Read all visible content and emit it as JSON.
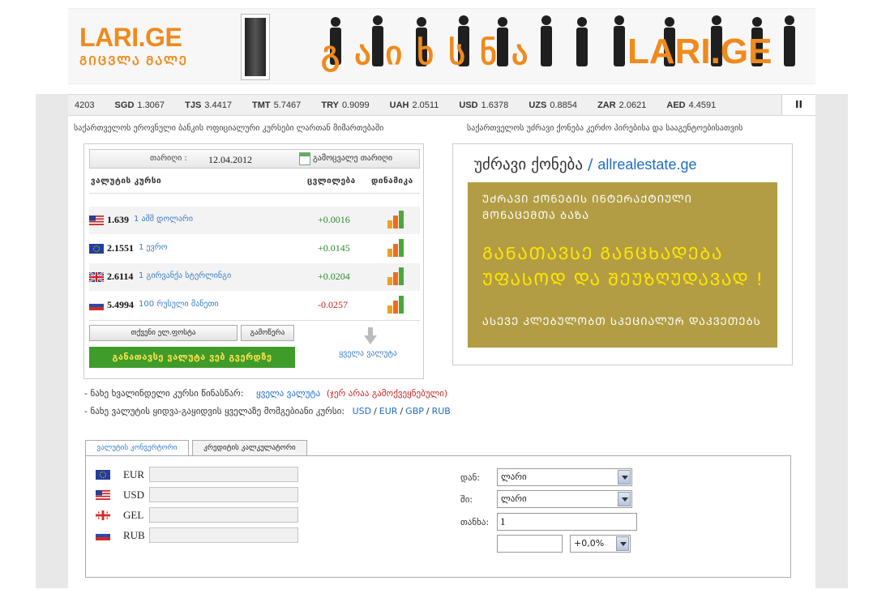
{
  "header": {
    "logo_main": "LARI.GE",
    "logo_sub": "ᲒᲘᲪᲕᲚᲐ ᲛᲐᲚᲔ",
    "banner_geo": "გაიხსნა",
    "banner_lari": "LARI.GE"
  },
  "ticker": {
    "items": [
      {
        "code": "",
        "value": "4203"
      },
      {
        "code": "SGD",
        "value": "1.3067"
      },
      {
        "code": "TJS",
        "value": "3.4417"
      },
      {
        "code": "TMT",
        "value": "5.7467"
      },
      {
        "code": "TRY",
        "value": "0.9099"
      },
      {
        "code": "UAH",
        "value": "2.0511"
      },
      {
        "code": "USD",
        "value": "1.6378"
      },
      {
        "code": "UZS",
        "value": "0.8854"
      },
      {
        "code": "ZAR",
        "value": "2.0621"
      },
      {
        "code": "AED",
        "value": "4.4591"
      }
    ],
    "pause_label": "II"
  },
  "titles": {
    "left": "საქართველოს ეროვნული ბანკის ოფიციალური კურსები ლართან მიმართებაში",
    "right": "საქართველოს უძრავი ქონება კერძო პირებისა და სააგენტოებისათვის"
  },
  "rates": {
    "date_label": "თარიღი :",
    "date_value": "12.04.2012",
    "change_date": "გამოცვალე თარიღი",
    "head_currency": "ვალუტის კურსი",
    "head_change": "ცვლილება",
    "head_dynamics": "დინამიკა",
    "rows": [
      {
        "value": "1.639",
        "name": "1 აშშ დოლარი",
        "diff": "+0.0016",
        "flag": "us"
      },
      {
        "value": "2.1551",
        "name": "1 ევრო",
        "diff": "+0.0145",
        "flag": "eu"
      },
      {
        "value": "2.6114",
        "name": "1 გირვანქა სტერლინგი",
        "diff": "+0.0204",
        "flag": "gb"
      },
      {
        "value": "5.4994",
        "name": "100 რუსული მანეთი",
        "diff": "-0.0257",
        "flag": "ru"
      }
    ],
    "email_button": "თქვენი ელ.ფოსტა",
    "subscribe_button": "გამოწერა",
    "place_button": "განათავსე ვალუტა ვებ გვერდზე",
    "all_currencies": "ყველა ვალუტა"
  },
  "ad": {
    "title": "უძრავი ქონება",
    "sep": "/",
    "url": "allrealestate.ge",
    "line1a": "ᲣᲫᲠᲐᲕᲘ ᲥᲝᲜᲔᲑᲘᲡ ᲘᲜᲢᲔᲠᲐᲥᲢᲘᲣᲚᲘ",
    "line1b": "ᲛᲝᲜᲐᲪᲔᲛᲗᲐ ᲑᲐᲖᲐ",
    "line2a": "ᲒᲐᲜᲐᲗᲐᲕᲡᲔ ᲒᲐᲜᲪᲮᲐᲓᲔᲑᲐ",
    "line2b": "ᲣᲤᲐᲡᲝᲓ ᲓᲐ ᲨᲔᲣᲖᲦᲣᲓᲐᲕᲐᲓ !",
    "line3": "ᲐᲡᲔᲕᲔ ᲙᲚᲔᲑᲣᲚᲝᲑᲗ ᲡᲞᲔᲪᲘᲐᲚᲣᲠ ᲓᲐᲙᲕᲔᲗᲔᲑᲡ"
  },
  "info": {
    "line1_text": "- ნახე ხვალინდელი კურსი წინასწარ:",
    "line1_link": "ყველა ვალუტა",
    "line1_note": "(ჯერ არაა გამოქვეყნებული)",
    "line2_text": "- ნახე ვალუტის ყიდვა-გაყიდვის ყველაზე მომგებიანი კურსი:",
    "links": [
      "USD",
      "EUR",
      "GBP",
      "RUB"
    ],
    "sep": "/"
  },
  "converter": {
    "tabs": [
      "ვალუტის კონვერტორი",
      "კრედიტის კალკულატორი"
    ],
    "currencies": [
      {
        "code": "EUR",
        "flag": "eu",
        "value": ""
      },
      {
        "code": "USD",
        "flag": "us",
        "value": ""
      },
      {
        "code": "GEL",
        "flag": "ge",
        "value": ""
      },
      {
        "code": "RUB",
        "flag": "ru",
        "value": ""
      }
    ],
    "from_label": "დან:",
    "from_value": "ლარი",
    "to_label": "ში:",
    "to_value": "ლარი",
    "amount_label": "თანხა:",
    "amount_value": "1",
    "result_value": "",
    "percent_value": "+0,0%"
  }
}
